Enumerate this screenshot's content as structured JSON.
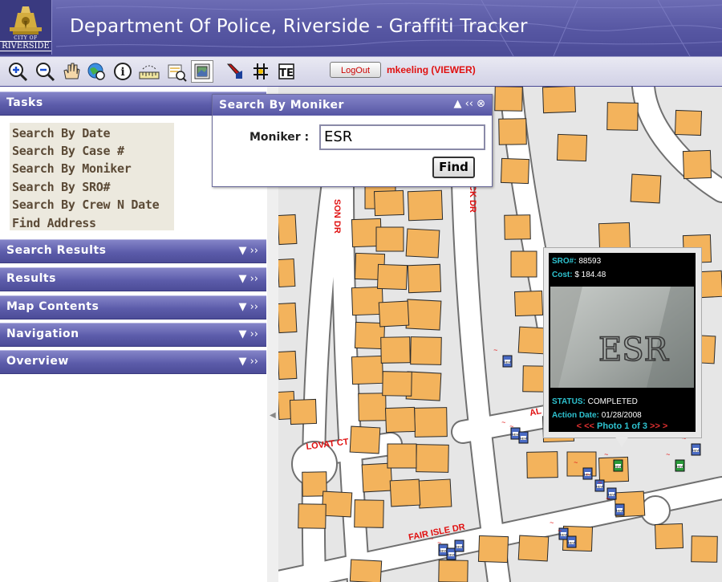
{
  "header": {
    "title": "Department Of Police, Riverside - Graffiti Tracker",
    "logo_small": "CITY OF",
    "logo_text": "RIVERSIDE"
  },
  "toolbar": {
    "tools": [
      "zoom-in",
      "zoom-out",
      "pan",
      "full-extent",
      "identify",
      "measure",
      "find-graffiti",
      "layers",
      "select",
      "graffiti-marker",
      "grid"
    ],
    "logout_label": "LogOut",
    "user_label": "mkeeling (VIEWER)"
  },
  "tasks": {
    "title": "Tasks",
    "items": [
      "Search By Date",
      "Search By Case #",
      "Search By Moniker",
      "Search By SRO#",
      "Search By Crew N Date",
      "Find Address"
    ]
  },
  "panels": [
    "Search Results",
    "Results",
    "Map Contents",
    "Navigation",
    "Overview"
  ],
  "dialog": {
    "title": "Search By Moniker",
    "field_label": "Moniker :",
    "field_value": "ESR",
    "find_label": "Find"
  },
  "popup": {
    "sro_label": "SRO#:",
    "sro_value": "88593",
    "cost_label": "Cost:",
    "cost_value": "$ 184.48",
    "status_label": "STATUS:",
    "status_value": "COMPLETED",
    "date_label": "Action Date:",
    "date_value": "01/28/2008",
    "prev": "< <<",
    "photo_counter": "Photo 1 of 3",
    "next": ">> >",
    "tag_text": "ESR"
  },
  "map": {
    "streets": [
      "SON DR",
      "CK DR",
      "LOVAT CT",
      "FAIR ISLE DR",
      "AL"
    ],
    "marker_label": "NEW"
  },
  "colors": {
    "header": "#5656a2",
    "panel_bar": "#5c5caa",
    "roof": "#f3b35c",
    "road": "#ffffff",
    "street_label": "#e01010",
    "popup_text": "#2ec2cf"
  }
}
